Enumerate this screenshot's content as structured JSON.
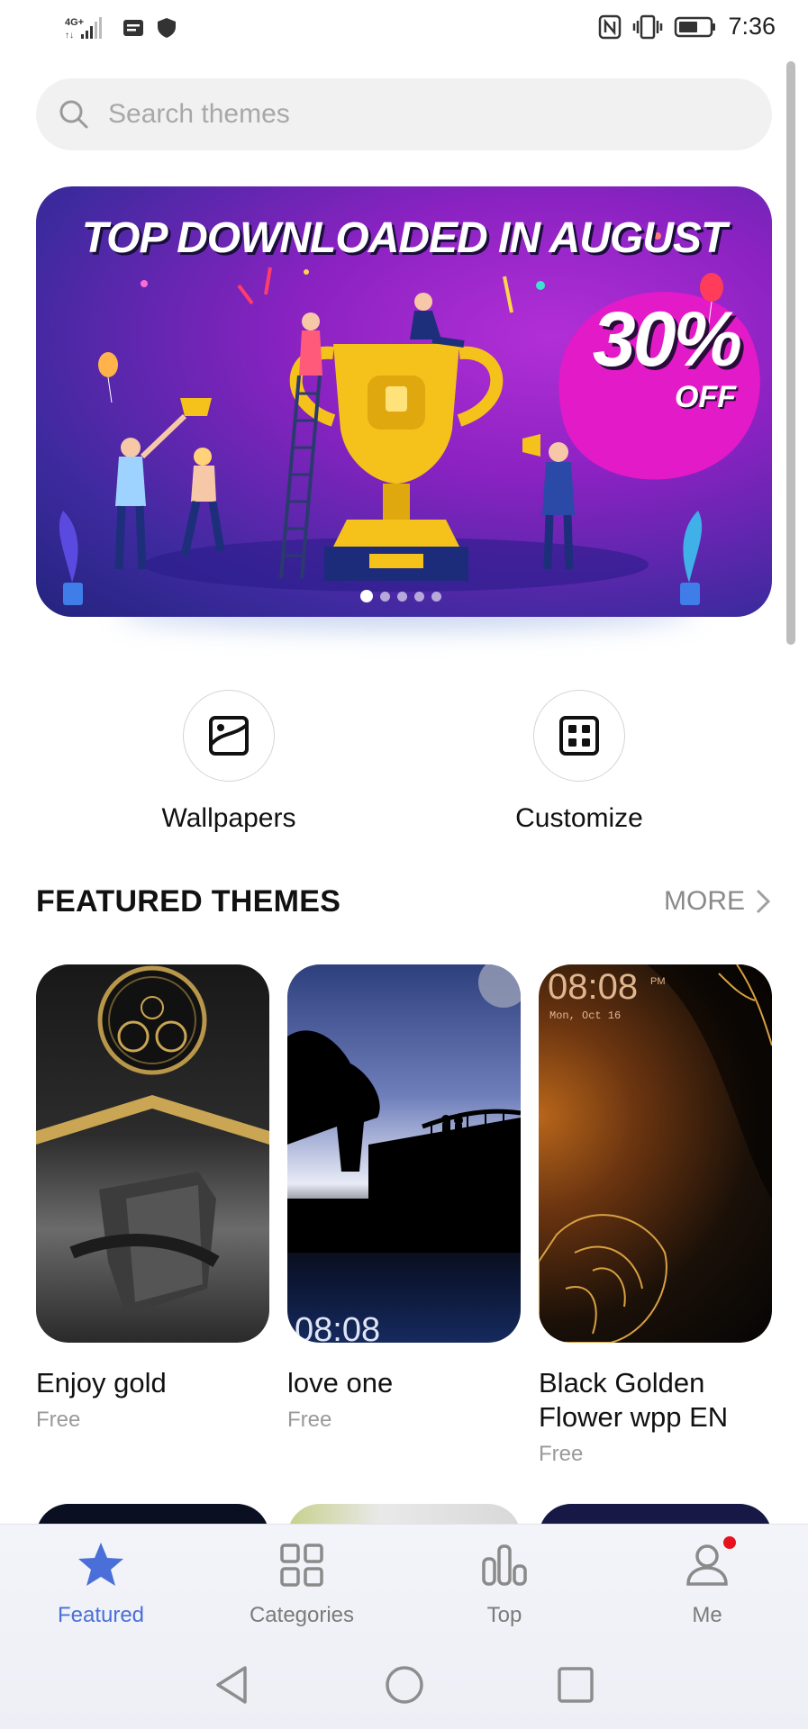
{
  "status_bar": {
    "network": "4G",
    "time": "7:36",
    "icons": [
      "signal-icon",
      "message-icon",
      "shield-icon",
      "nfc-icon",
      "vibrate-icon",
      "battery-icon"
    ]
  },
  "search": {
    "placeholder": "Search themes"
  },
  "banner": {
    "title": "TOP DOWNLOADED IN AUGUST",
    "discount": "30%",
    "discount_suffix": "OFF",
    "page_count": 5,
    "active_page": 1
  },
  "quick_entries": [
    {
      "label": "Wallpapers",
      "icon": "wallpaper-icon"
    },
    {
      "label": "Customize",
      "icon": "customize-icon"
    }
  ],
  "featured": {
    "title": "FEATURED THEMES",
    "more_label": "MORE",
    "themes": [
      {
        "name": "Enjoy gold",
        "price": "Free"
      },
      {
        "name": "love one",
        "price": "Free",
        "clock": "08:08"
      },
      {
        "name": "Black Golden Flower wpp EN",
        "price": "Free",
        "clock": "08:08",
        "ampm": "PM",
        "date": "Mon, Oct 16"
      }
    ]
  },
  "bottom_nav": {
    "items": [
      {
        "label": "Featured",
        "icon": "star-icon",
        "active": true
      },
      {
        "label": "Categories",
        "icon": "grid-icon",
        "active": false
      },
      {
        "label": "Top",
        "icon": "bar-chart-icon",
        "active": false
      },
      {
        "label": "Me",
        "icon": "person-icon",
        "active": false,
        "badge": true
      }
    ]
  },
  "colors": {
    "accent": "#4a6fd8",
    "badge": "#e8121d"
  }
}
